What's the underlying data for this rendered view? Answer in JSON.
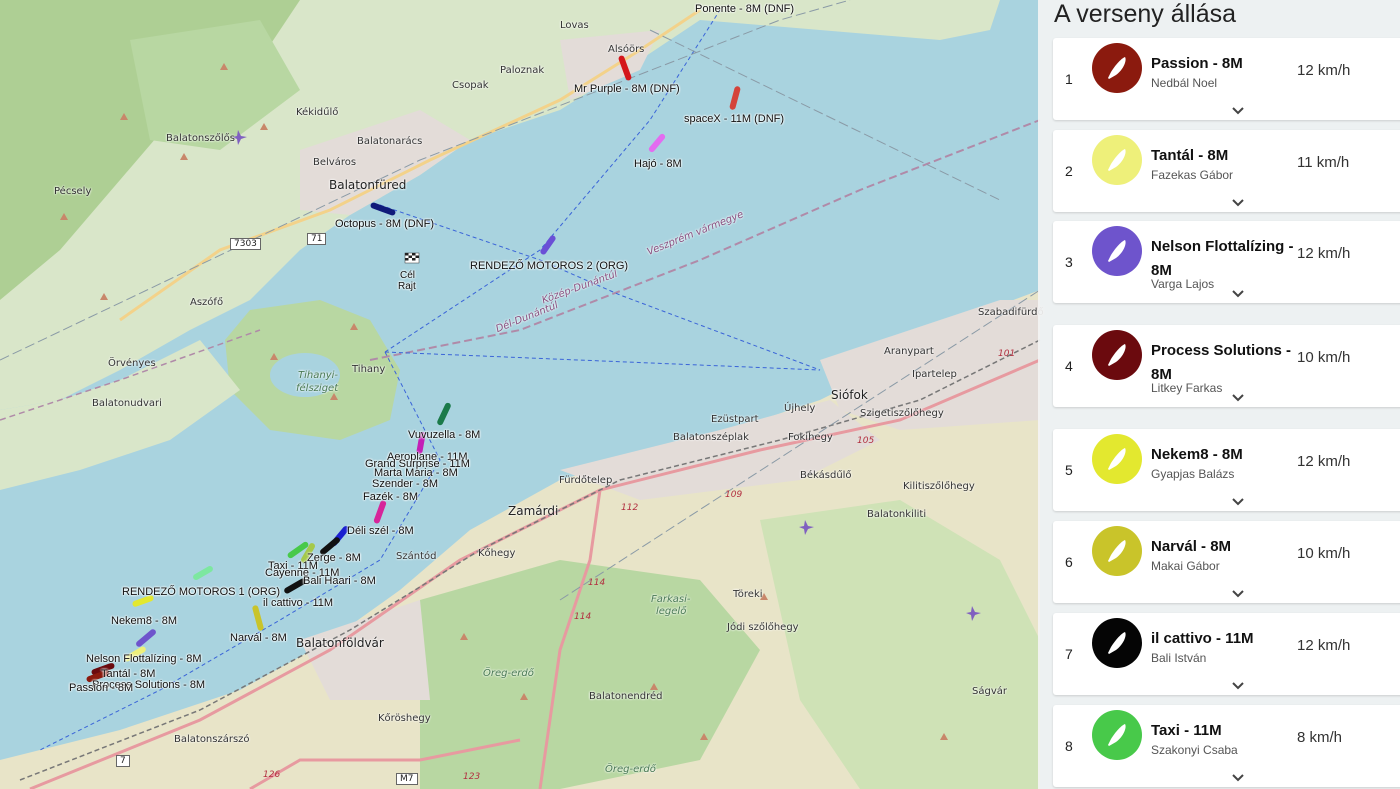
{
  "panel": {
    "title": "A verseny állása"
  },
  "standings": [
    {
      "rank": "1",
      "name": "Passion - 8M",
      "skipper": "Nedbál Noel",
      "speed": "12 km/h",
      "color": "#8b1a0e"
    },
    {
      "rank": "2",
      "name": "Tantál - 8M",
      "skipper": "Fazekas Gábor",
      "speed": "11 km/h",
      "color": "#eef07a"
    },
    {
      "rank": "3",
      "name": "Nelson Flottalízing - 8M",
      "skipper": "Varga Lajos",
      "speed": "12 km/h",
      "color": "#6e54cc"
    },
    {
      "rank": "4",
      "name": "Process Solutions - 8M",
      "skipper": "Litkey Farkas",
      "speed": "10 km/h",
      "color": "#6b0a0e"
    },
    {
      "rank": "5",
      "name": "Nekem8 - 8M",
      "skipper": "Gyapjas Balázs",
      "speed": "12 km/h",
      "color": "#e3e82f"
    },
    {
      "rank": "6",
      "name": "Narvál - 8M",
      "skipper": "Makai Gábor",
      "speed": "10 km/h",
      "color": "#c9c42a"
    },
    {
      "rank": "7",
      "name": "il cattivo - 11M",
      "skipper": "Bali István",
      "speed": "12 km/h",
      "color": "#050505"
    },
    {
      "rank": "8",
      "name": "Taxi - 11M",
      "skipper": "Szakonyi Csaba",
      "speed": "8 km/h",
      "color": "#48c94a"
    }
  ],
  "map": {
    "places": [
      {
        "name": "Lovas",
        "cls": "place"
      },
      {
        "name": "Alsóörs",
        "cls": "place"
      },
      {
        "name": "Paloznak",
        "cls": "place"
      },
      {
        "name": "Csopak",
        "cls": "place"
      },
      {
        "name": "Kékidűlő",
        "cls": "place"
      },
      {
        "name": "Balatonszőlős",
        "cls": "place"
      },
      {
        "name": "Balatonarács",
        "cls": "place"
      },
      {
        "name": "Belváros",
        "cls": "place"
      },
      {
        "name": "Balatonfüred",
        "cls": "place town"
      },
      {
        "name": "Pécsely",
        "cls": "place"
      },
      {
        "name": "Aszófő",
        "cls": "place"
      },
      {
        "name": "Örvényes",
        "cls": "place"
      },
      {
        "name": "Balatonudvari",
        "cls": "place"
      },
      {
        "name": "Tihanyi-",
        "cls": "place italic"
      },
      {
        "name": "félsziget",
        "cls": "place italic"
      },
      {
        "name": "Tihany",
        "cls": "place"
      },
      {
        "name": "Szabadifürdő",
        "cls": "place"
      },
      {
        "name": "Aranypart",
        "cls": "place"
      },
      {
        "name": "Ipartelep",
        "cls": "place"
      },
      {
        "name": "Siófok",
        "cls": "place town"
      },
      {
        "name": "Szigetiszőlőhegy",
        "cls": "place"
      },
      {
        "name": "Ezüstpart",
        "cls": "place"
      },
      {
        "name": "Újhely",
        "cls": "place"
      },
      {
        "name": "Fokihegy",
        "cls": "place"
      },
      {
        "name": "Balatonszéplak",
        "cls": "place"
      },
      {
        "name": "Békásdűlő",
        "cls": "place"
      },
      {
        "name": "Kilitiszőlőhegy",
        "cls": "place"
      },
      {
        "name": "Balatonkiliti",
        "cls": "place"
      },
      {
        "name": "Fürdőtelep",
        "cls": "place"
      },
      {
        "name": "Zamárdi",
        "cls": "place town"
      },
      {
        "name": "Kőhegy",
        "cls": "place"
      },
      {
        "name": "Szántód",
        "cls": "place"
      },
      {
        "name": "Farkasi-",
        "cls": "place italic"
      },
      {
        "name": "legelő",
        "cls": "place italic"
      },
      {
        "name": "Töreki",
        "cls": "place"
      },
      {
        "name": "Jódi szőlőhegy",
        "cls": "place"
      },
      {
        "name": "Balatonföldvár",
        "cls": "place town"
      },
      {
        "name": "Öreg-erdő",
        "cls": "place italic"
      },
      {
        "name": "Balatonendréd",
        "cls": "place"
      },
      {
        "name": "Kőröshegy",
        "cls": "place"
      },
      {
        "name": "Balatonszárszó",
        "cls": "place"
      },
      {
        "name": "Öreg-erdő",
        "cls": "place italic"
      },
      {
        "name": "Ságvár",
        "cls": "place"
      },
      {
        "name": "Veszprém vármegye",
        "cls": "place water"
      },
      {
        "name": "Közép-Dunántúl",
        "cls": "place water"
      },
      {
        "name": "Dél-Dunántúl",
        "cls": "place water"
      }
    ],
    "shields": [
      "7303",
      "71",
      "7",
      "M7"
    ],
    "red_roads": [
      "101",
      "105",
      "109",
      "112",
      "114",
      "114",
      "123",
      "126"
    ],
    "finish_label": "Cél",
    "start_label": "Rajt",
    "boat_labels": [
      "Ponente - 8M (DNF)",
      "Mr Purple - 8M (DNF)",
      "spaceX - 11M (DNF)",
      "Hajó - 8M",
      "Octopus - 8M (DNF)",
      "RENDEZŐ MOTOROS 2 (ORG)",
      "Vuvuzella - 8M",
      "Aeroplane - 11M",
      "Grand Surprise - 11M",
      "Marta Maria - 8M",
      "Szender - 8M",
      "Fazék - 8M",
      "Déli szél - 8M",
      "Zerge - 8M",
      "Taxi - 11M",
      "Cayenne - 11M",
      "Bali Haari - 8M",
      "il cattivo - 11M",
      "RENDEZŐ MOTOROS 1 (ORG)",
      "Nekem8 - 8M",
      "Narvál - 8M",
      "Nelson Flottalízing - 8M",
      "Tantál - 8M",
      "Process Solutions - 8M",
      "Passion - 8M"
    ]
  }
}
